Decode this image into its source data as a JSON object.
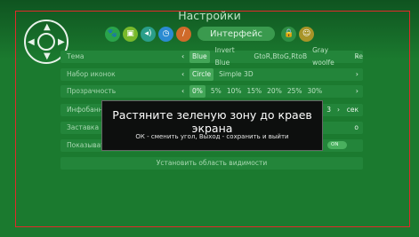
{
  "header": {
    "title": "Настройки"
  },
  "toolbar": {
    "icons": [
      "paw-icon",
      "image-icon",
      "sound-icon",
      "clock-icon",
      "brush-icon",
      "lock-icon",
      "face-icon"
    ],
    "active_tab": "Интерфейс"
  },
  "rows": [
    {
      "label": "Тема",
      "options": [
        "Blue",
        "Invert Blue",
        "GtoR,BtoG,RtoB",
        "Gray woolfe",
        "Re"
      ],
      "selected": "Blue"
    },
    {
      "label": "Набор иконок",
      "options": [
        "Circle",
        "Simple 3D"
      ],
      "selected": "Circle"
    },
    {
      "label": "Прозрачность",
      "options": [
        "0%",
        "5%",
        "10%",
        "15%",
        "20%",
        "25%",
        "30%"
      ],
      "selected": "0%"
    },
    {
      "label": "Инфобанне",
      "trailing": "3",
      "unit": "сек"
    },
    {
      "label": "Заставка",
      "trailing": "о"
    },
    {
      "label": "Показыват",
      "toggle": "ON"
    }
  ],
  "visible_area_button": "Установить область видимости",
  "dialog": {
    "heading": "Растяните зеленую зону до краев экрана",
    "hint": "ОК - сменить угол, Выход - сохранить и выйти"
  },
  "colors": {
    "frame": "#e02a2a",
    "background": "#1b7a2f",
    "dialog": "#0d0f0e"
  }
}
